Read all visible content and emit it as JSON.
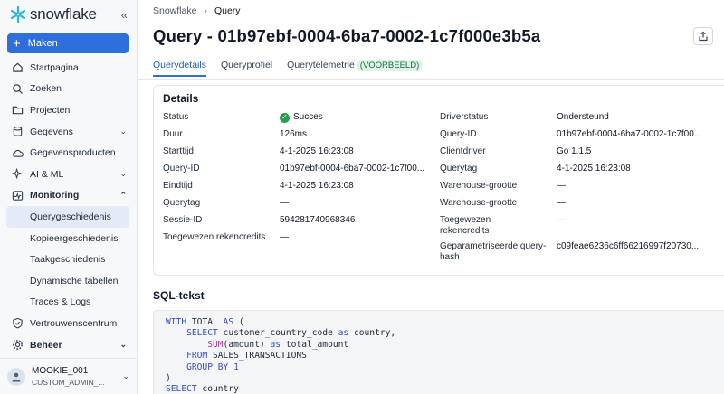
{
  "app": {
    "logo_text": "snowflake"
  },
  "sidebar": {
    "make_button": "Maken",
    "items": [
      {
        "label": "Startpagina",
        "icon": "home-icon"
      },
      {
        "label": "Zoeken",
        "icon": "search-icon"
      },
      {
        "label": "Projecten",
        "icon": "folder-icon"
      },
      {
        "label": "Gegevens",
        "icon": "database-icon",
        "chevron": true
      },
      {
        "label": "Gegevensproducten",
        "icon": "cloud-icon"
      },
      {
        "label": "AI & ML",
        "icon": "sparkle-icon",
        "chevron": true
      },
      {
        "label": "Monitoring",
        "icon": "activity-icon",
        "chevron": true,
        "expanded": true
      }
    ],
    "monitoring_sub": [
      "Querygeschiedenis",
      "Kopieergeschiedenis",
      "Taakgeschiedenis",
      "Dynamische tabellen",
      "Traces & Logs"
    ],
    "bottom_items": [
      {
        "label": "Vertrouwenscentrum",
        "icon": "shield-icon"
      },
      {
        "label": "Beheer",
        "icon": "settings-icon",
        "chevron": true
      }
    ],
    "user": {
      "name": "MOOKIE_001",
      "role": "CUSTOM_ADMIN_..."
    }
  },
  "breadcrumb": {
    "parent": "Snowflake",
    "current": "Query"
  },
  "page_title": "Query - 01b97ebf-0004-6ba7-0002-1c7f000e3b5a",
  "tabs": [
    {
      "label": "Querydetails",
      "active": true
    },
    {
      "label": "Queryprofiel"
    },
    {
      "label": "Querytelemetrie",
      "badge": "(VOORBEELD)"
    }
  ],
  "details": {
    "title": "Details",
    "left": [
      {
        "label": "Status",
        "value": "Succes"
      },
      {
        "label": "Duur",
        "value": "126ms"
      },
      {
        "label": "Starttijd",
        "value": "4-1-2025 16:23:08"
      },
      {
        "label": "Query-ID",
        "value": "01b97ebf-0004-6ba7-0002-1c7f00..."
      },
      {
        "label": "Eindtijd",
        "value": "4-1-2025 16:23:08"
      },
      {
        "label": "Querytag",
        "value": "—"
      },
      {
        "label": "Sessie-ID",
        "value": "594281740968346"
      },
      {
        "label": "Toegewezen rekencredits",
        "value": "—"
      }
    ],
    "right": [
      {
        "label": "Driverstatus",
        "value": "Ondersteund"
      },
      {
        "label": "Query-ID",
        "value": "01b97ebf-0004-6ba7-0002-1c7f00..."
      },
      {
        "label": "Clientdriver",
        "value": "Go 1.1.5"
      },
      {
        "label": "Querytag",
        "value": "4-1-2025 16:23:08"
      },
      {
        "label": "Warehouse-grootte",
        "value": "—"
      },
      {
        "label": "Warehouse-grootte",
        "value": "—"
      },
      {
        "label": "Toegewezen rekencredits",
        "value": "—"
      },
      {
        "label": "Geparametriseerde query-hash",
        "value": "c09feae6236c6ff66216997f20730..."
      }
    ]
  },
  "sql": {
    "title": "SQL-tekst",
    "lines": [
      "WITH TOTAL AS (",
      "    SELECT customer_country_code as country,",
      "        SUM(amount) as total_amount",
      "    FROM SALES_TRANSACTIONS",
      "    GROUP BY 1",
      ")",
      "SELECT country"
    ]
  },
  "colors": {
    "accent": "#2f6fdc",
    "success": "#22a04b",
    "badge_bg": "#dff3e6"
  }
}
